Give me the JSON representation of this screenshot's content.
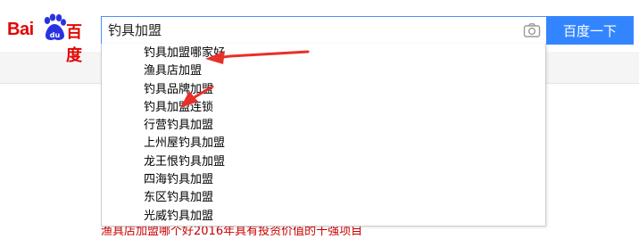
{
  "logo": {
    "text_bai": "Bai",
    "text_du": "百度"
  },
  "search": {
    "query": "钓具加盟",
    "button_label": "百度一下"
  },
  "suggestions": [
    "钓具加盟哪家好",
    "渔具店加盟",
    "钓具品牌加盟",
    "钓具加盟连锁",
    "行营钓具加盟",
    "上州屋钓具加盟",
    "龙王恨钓具加盟",
    "四海钓具加盟",
    "东区钓具加盟",
    "光威钓具加盟"
  ],
  "result_snippet": "渔具店加盟哪个好2016年具有投资价值的十强项目",
  "icons": {
    "camera": "camera-icon",
    "logo_paw": "paw-icon",
    "annotation_arrows": "red-arrow-icon"
  },
  "colors": {
    "brand_red": "#e10601",
    "brand_blue": "#3385ff",
    "annotation_red": "#e8302a"
  }
}
